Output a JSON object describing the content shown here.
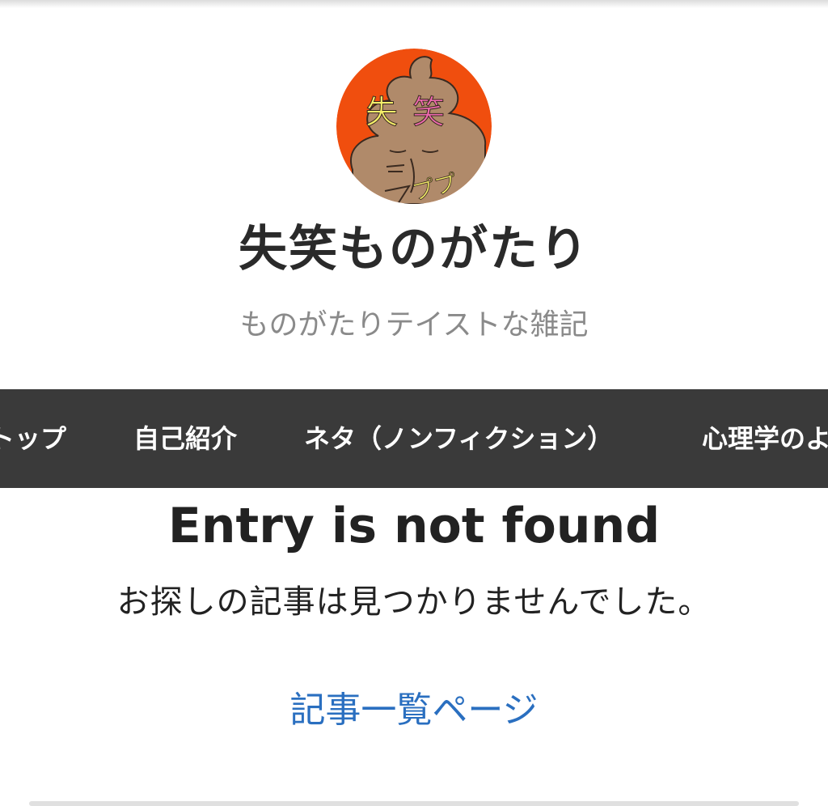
{
  "header": {
    "avatar_icon": "poop-character-icon",
    "avatar_text_1": "失",
    "avatar_text_2": "笑",
    "avatar_text_3": "ププ",
    "title": "失笑ものがたり",
    "description": "ものがたりテイストな雑記"
  },
  "nav": {
    "items": [
      {
        "label": "トップ"
      },
      {
        "label": "自己紹介"
      },
      {
        "label": "ネタ（ノンフィクション）"
      },
      {
        "label": "心理学のよ"
      }
    ]
  },
  "main": {
    "error_title": "Entry is not found",
    "error_message": "お探しの記事は見つかりませんでした。",
    "archive_link": "記事一覧ページ"
  },
  "colors": {
    "nav_background": "#3a3a3a",
    "link": "#2a6fc0",
    "avatar_background": "#f04e0e",
    "avatar_character": "#b08a6a"
  }
}
